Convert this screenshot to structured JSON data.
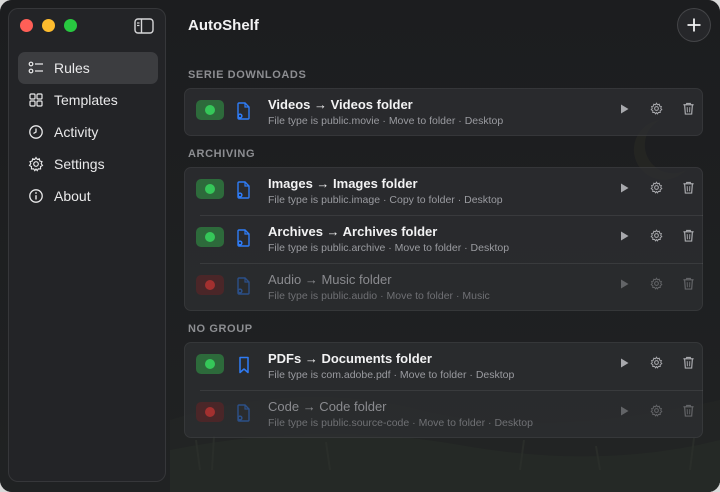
{
  "app": {
    "title": "AutoShelf"
  },
  "colors": {
    "accent_blue": "#2f7cf6",
    "enabled_green": "#35c759",
    "disabled_red": "#a3302f"
  },
  "sidebar": {
    "items": [
      {
        "label": "Rules",
        "icon": "list-icon",
        "active": true
      },
      {
        "label": "Templates",
        "icon": "grid-icon",
        "active": false
      },
      {
        "label": "Activity",
        "icon": "clock-icon",
        "active": false
      },
      {
        "label": "Settings",
        "icon": "gear-icon",
        "active": false
      },
      {
        "label": "About",
        "icon": "info-icon",
        "active": false
      }
    ]
  },
  "groups": [
    {
      "title": "SERIE DOWNLOADS",
      "rules": [
        {
          "title": "Videos → Videos folder",
          "condition": "File type is public.movie",
          "action": "Move to folder",
          "destination": "Desktop",
          "enabled": true,
          "icon": "document-gear-icon"
        }
      ]
    },
    {
      "title": "ARCHIVING",
      "rules": [
        {
          "title": "Images → Images folder",
          "condition": "File type is public.image",
          "action": "Copy to folder",
          "destination": "Desktop",
          "enabled": true,
          "icon": "document-gear-icon"
        },
        {
          "title": "Archives → Archives folder",
          "condition": "File type is public.archive",
          "action": "Move to folder",
          "destination": "Desktop",
          "enabled": true,
          "icon": "document-gear-icon"
        },
        {
          "title": "Audio → Music folder",
          "condition": "File type is public.audio",
          "action": "Move to folder",
          "destination": "Music",
          "enabled": false,
          "icon": "document-gear-icon"
        }
      ]
    },
    {
      "title": "NO GROUP",
      "rules": [
        {
          "title": "PDFs → Documents folder",
          "condition": "File type is com.adobe.pdf",
          "action": "Move to folder",
          "destination": "Desktop",
          "enabled": true,
          "icon": "bookmark-icon"
        },
        {
          "title": "Code → Code folder",
          "condition": "File type is public.source-code",
          "action": "Move to folder",
          "destination": "Desktop",
          "enabled": false,
          "icon": "document-gear-icon"
        }
      ]
    }
  ],
  "separator": " · "
}
